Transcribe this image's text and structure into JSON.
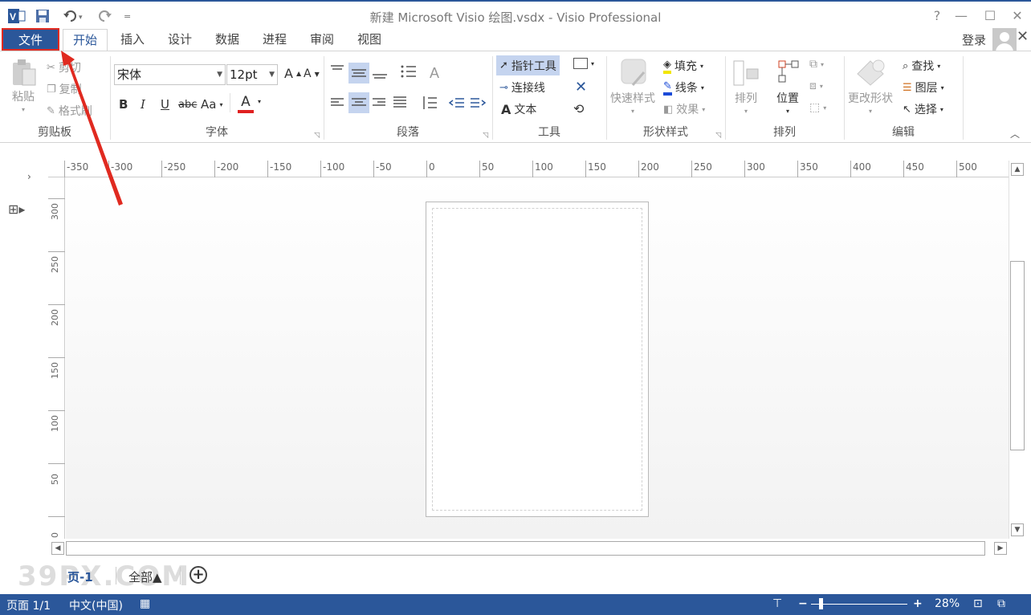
{
  "window": {
    "title": "新建 Microsoft Visio 绘图.vsdx - Visio Professional",
    "help": "?",
    "quick_access_more": "=",
    "app_icon": "visio-logo-icon",
    "save_icon": "save-icon",
    "undo_icon": "undo-icon",
    "redo_icon": "redo-icon"
  },
  "tabs": {
    "file": "文件",
    "items": [
      "开始",
      "插入",
      "设计",
      "数据",
      "进程",
      "审阅",
      "视图"
    ],
    "active": "开始",
    "login": "登录"
  },
  "ribbon": {
    "clipboard": {
      "label": "剪贴板",
      "paste": "粘贴",
      "cut": "剪切",
      "copy": "复制",
      "format_painter": "格式刷"
    },
    "font": {
      "label": "字体",
      "font_name": "宋体",
      "font_size": "12pt",
      "bold": "B",
      "italic": "I",
      "underline": "U",
      "strikethrough": "abc",
      "change_case": "Aa",
      "font_color": "A",
      "grow": "A",
      "shrink": "A",
      "font_color_value": "#e02020"
    },
    "paragraph": {
      "label": "段落"
    },
    "tools": {
      "label": "工具",
      "pointer": "指针工具",
      "connector": "连接线",
      "text": "文本"
    },
    "shape_styles": {
      "label": "形状样式",
      "quick_styles": "快速样式",
      "fill": "填充",
      "line": "线条",
      "effects": "效果"
    },
    "arrange": {
      "label": "排列",
      "arrange": "排列",
      "position": "位置"
    },
    "editing": {
      "label": "编辑",
      "change_shape": "更改形状",
      "find": "查找",
      "layers": "图层",
      "select": "选择"
    }
  },
  "ruler": {
    "horizontal": [
      "-350",
      "-300",
      "-250",
      "-200",
      "-150",
      "-100",
      "-50",
      "0",
      "50",
      "100",
      "150",
      "200",
      "250",
      "300",
      "350",
      "400",
      "450",
      "500"
    ],
    "vertical": [
      "300",
      "250",
      "200",
      "150",
      "100",
      "50",
      "0"
    ]
  },
  "page_tabs": {
    "current": "页-1",
    "all": "全部▲",
    "add": "+",
    "watermark": "39PX.COM"
  },
  "status": {
    "page": "页面 1/1",
    "language": "中文(中国)",
    "zoom": "28%",
    "zoom_minus": "−",
    "zoom_plus": "+"
  },
  "colors": {
    "accent": "#2b579a",
    "highlight": "#e02a20"
  }
}
